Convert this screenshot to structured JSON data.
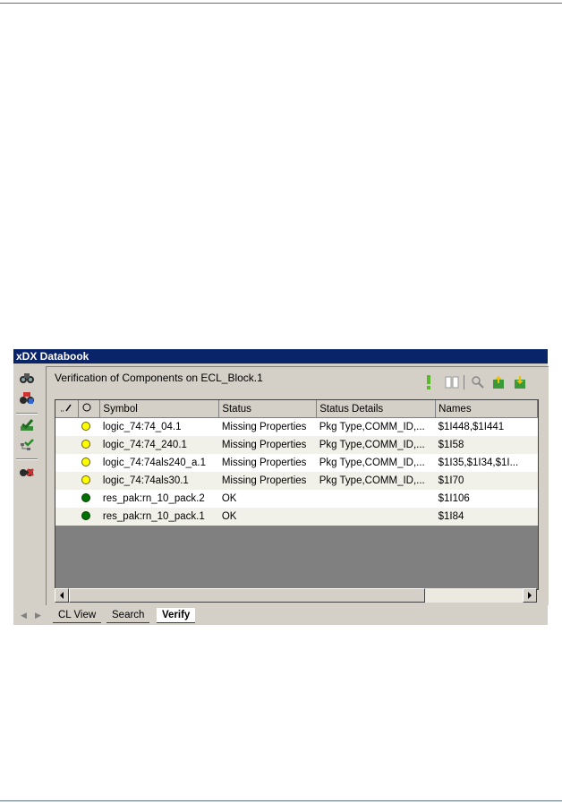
{
  "window": {
    "title": "xDX Databook"
  },
  "panel": {
    "heading": "Verification of Components on ECL_Block.1"
  },
  "grid": {
    "columns": [
      "",
      "",
      "Symbol",
      "Status",
      "Status Details",
      "Names"
    ],
    "rows": [
      {
        "status_color": "#ffff00",
        "symbol": "logic_74:74_04.1",
        "status": "Missing Properties",
        "details": "Pkg Type,COMM_ID,...",
        "names": "$1I448,$1I441"
      },
      {
        "status_color": "#ffff00",
        "symbol": "logic_74:74_240.1",
        "status": "Missing Properties",
        "details": "Pkg Type,COMM_ID,...",
        "names": "$1I58"
      },
      {
        "status_color": "#ffff00",
        "symbol": "logic_74:74als240_a.1",
        "status": "Missing Properties",
        "details": "Pkg Type,COMM_ID,...",
        "names": "$1I35,$1I34,$1I..."
      },
      {
        "status_color": "#ffff00",
        "symbol": "logic_74:74als30.1",
        "status": "Missing Properties",
        "details": "Pkg Type,COMM_ID,...",
        "names": "$1I70"
      },
      {
        "status_color": "#007000",
        "symbol": "res_pak:rn_10_pack.2",
        "status": "OK",
        "details": "",
        "names": "$1I106"
      },
      {
        "status_color": "#007000",
        "symbol": "res_pak:rn_10_pack.1",
        "status": "OK",
        "details": "",
        "names": "$1I84"
      }
    ]
  },
  "tabs": [
    "CL View",
    "Search",
    "Verify"
  ],
  "active_tab": "Verify",
  "icons": {
    "toolbar": [
      "binoculars-icon",
      "binoculars-add-icon",
      "green-check-icon",
      "tree-check-icon",
      "binoculars-remove-icon"
    ],
    "header": [
      "exclamation-icon",
      "book-icon",
      "zoom-icon",
      "export-icon",
      "import-icon"
    ]
  },
  "colors": {
    "title_bar": "#0a246a",
    "ok": "#007000",
    "warning": "#ffff00"
  }
}
